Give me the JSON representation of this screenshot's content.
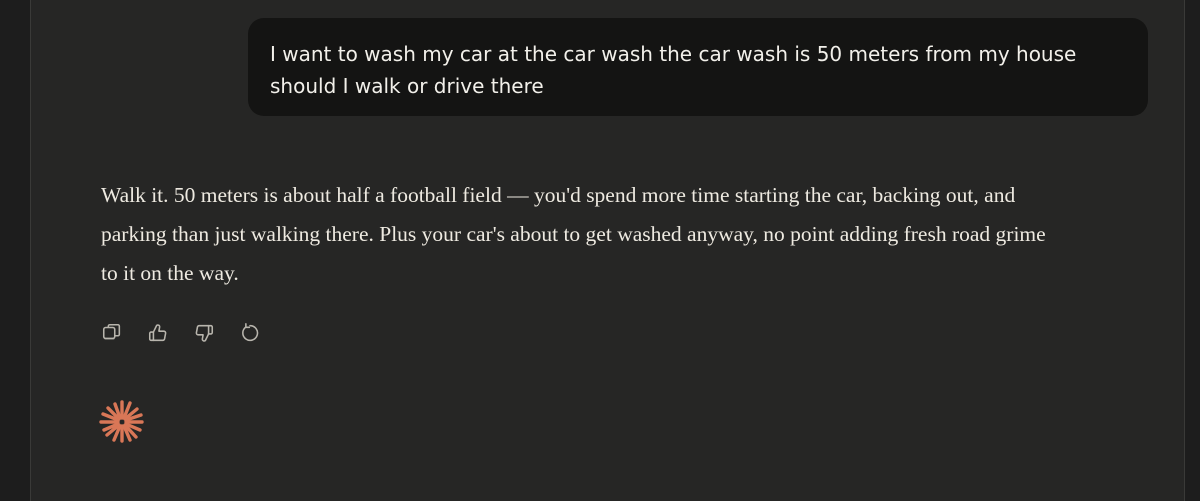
{
  "conversation": {
    "user_message": "I want to wash my car at the car wash the car wash is 50 meters from my house should I walk or drive there",
    "assistant_message": "Walk it. 50 meters is about half a football field — you'd spend more time starting the car, backing out, and parking than just walking there. Plus your car's about to get washed anyway, no point adding fresh road grime to it on the way."
  },
  "actions": {
    "items": [
      {
        "icon": "copy-icon"
      },
      {
        "icon": "thumbs-up-icon"
      },
      {
        "icon": "thumbs-down-icon"
      },
      {
        "icon": "retry-icon"
      }
    ]
  },
  "colors": {
    "page_background": "#1d1d1d",
    "panel_background": "#262625",
    "user_bubble": "#141413",
    "text": "#eeeae1",
    "icon": "#b8b5ad",
    "accent": "#d97757"
  }
}
